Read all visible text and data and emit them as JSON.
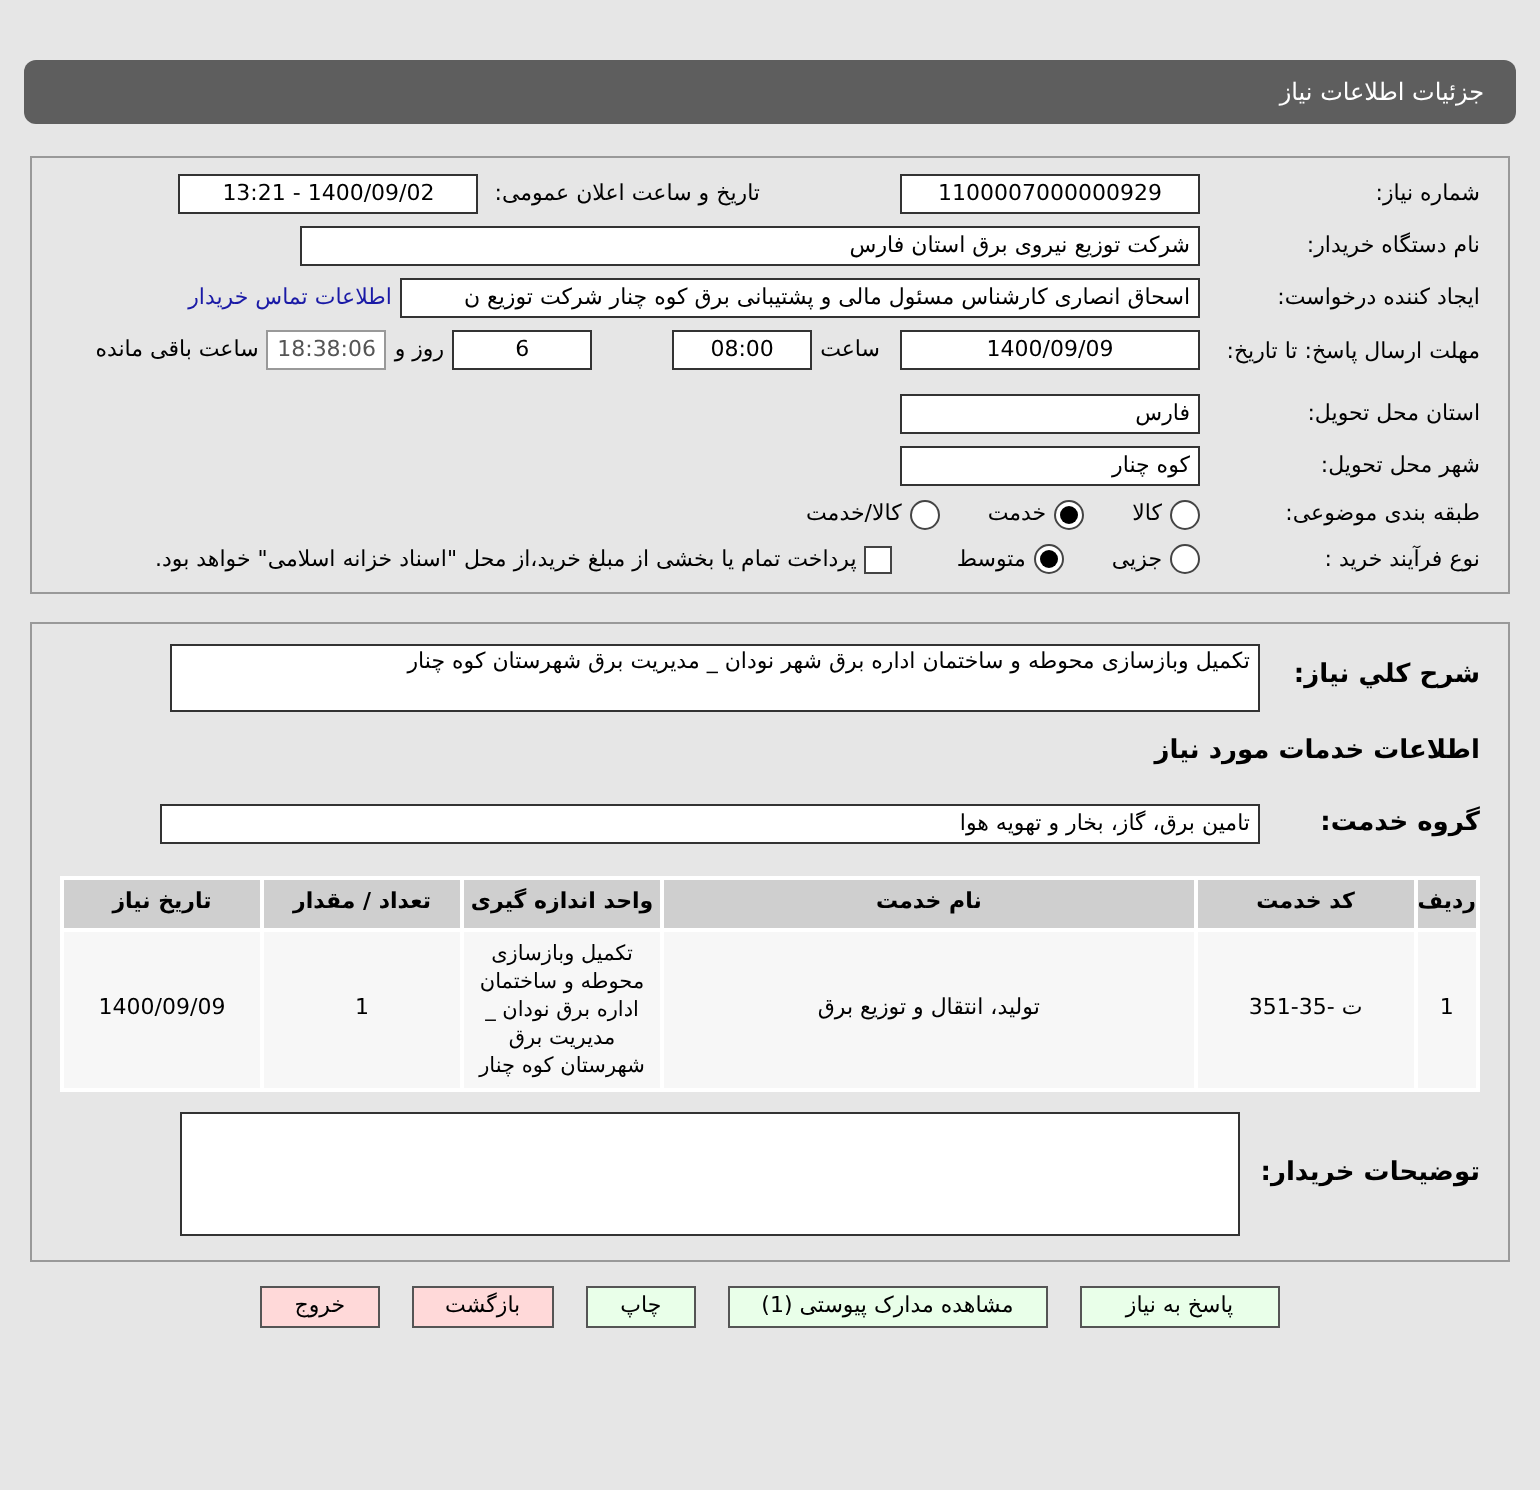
{
  "header": {
    "title": "جزئیات اطلاعات نیاز"
  },
  "need_number": {
    "label": "شماره نیاز:",
    "value": "1100007000000929"
  },
  "announce_date": {
    "label": "تاریخ و ساعت اعلان عمومی:",
    "value": "1400/09/02 - 13:21"
  },
  "buyer_org": {
    "label": "نام دستگاه خریدار:",
    "value": "شرکت توزیع نیروی برق استان فارس"
  },
  "requester": {
    "label": "ایجاد کننده درخواست:",
    "value": "اسحاق انصاری کارشناس مسئول مالی و پشتیبانی برق کوه چنار شرکت توزیع ن",
    "link": "اطلاعات تماس خریدار"
  },
  "deadline": {
    "label": "مهلت ارسال پاسخ: تا تاریخ:",
    "date": "1400/09/09",
    "time_label": "ساعت",
    "time": "08:00",
    "days": "6",
    "days_label": "روز و",
    "remaining": "18:38:06",
    "remaining_label": "ساعت باقی مانده"
  },
  "province": {
    "label": "استان محل تحویل:",
    "value": "فارس"
  },
  "city": {
    "label": "شهر محل تحویل:",
    "value": "کوه چنار"
  },
  "classification": {
    "label": "طبقه بندی موضوعی:",
    "options": [
      {
        "label": "کالا",
        "selected": false
      },
      {
        "label": "خدمت",
        "selected": true
      },
      {
        "label": "کالا/خدمت",
        "selected": false
      }
    ]
  },
  "purchase_process": {
    "label": "نوع فرآیند خرید :",
    "options": [
      {
        "label": "جزیی",
        "selected": false
      },
      {
        "label": "متوسط",
        "selected": true
      }
    ],
    "treasury": {
      "label": "پرداخت تمام یا بخشی از مبلغ خرید،از محل \"اسناد خزانه اسلامی\" خواهد بود.",
      "checked": false
    }
  },
  "description": {
    "label": "شرح کلي نياز:",
    "value": "تکمیل وبازسازی محوطه و ساختمان اداره برق  شهر نودان _ مدیریت برق شهرستان کوه چنار"
  },
  "services_title": "اطلاعات خدمات مورد نیاز",
  "service_group": {
    "label": "گروه خدمت:",
    "value": "تامین برق، گاز، بخار و تهویه هوا"
  },
  "table": {
    "columns": [
      "ردیف",
      "کد خدمت",
      "نام خدمت",
      "واحد اندازه گیری",
      "تعداد / مقدار",
      "تاریخ نیاز"
    ],
    "rows": [
      [
        "1",
        "ت -35-351",
        "تولید، انتقال و توزیع برق",
        "تکمیل وبازسازی محوطه و ساختمان اداره برق نودان _ مدیریت برق شهرستان کوه چنار",
        "1",
        "1400/09/09"
      ]
    ]
  },
  "buyer_notes": {
    "label": "توضیحات خریدار:"
  },
  "buttons": [
    {
      "label": "پاسخ به نیاز",
      "kind": "normal"
    },
    {
      "label": "مشاهده مدارک پیوستی (1)",
      "kind": "normal"
    },
    {
      "label": "چاپ",
      "kind": "normal"
    },
    {
      "label": "بازگشت",
      "kind": "danger"
    },
    {
      "label": "خروج",
      "kind": "danger"
    }
  ]
}
